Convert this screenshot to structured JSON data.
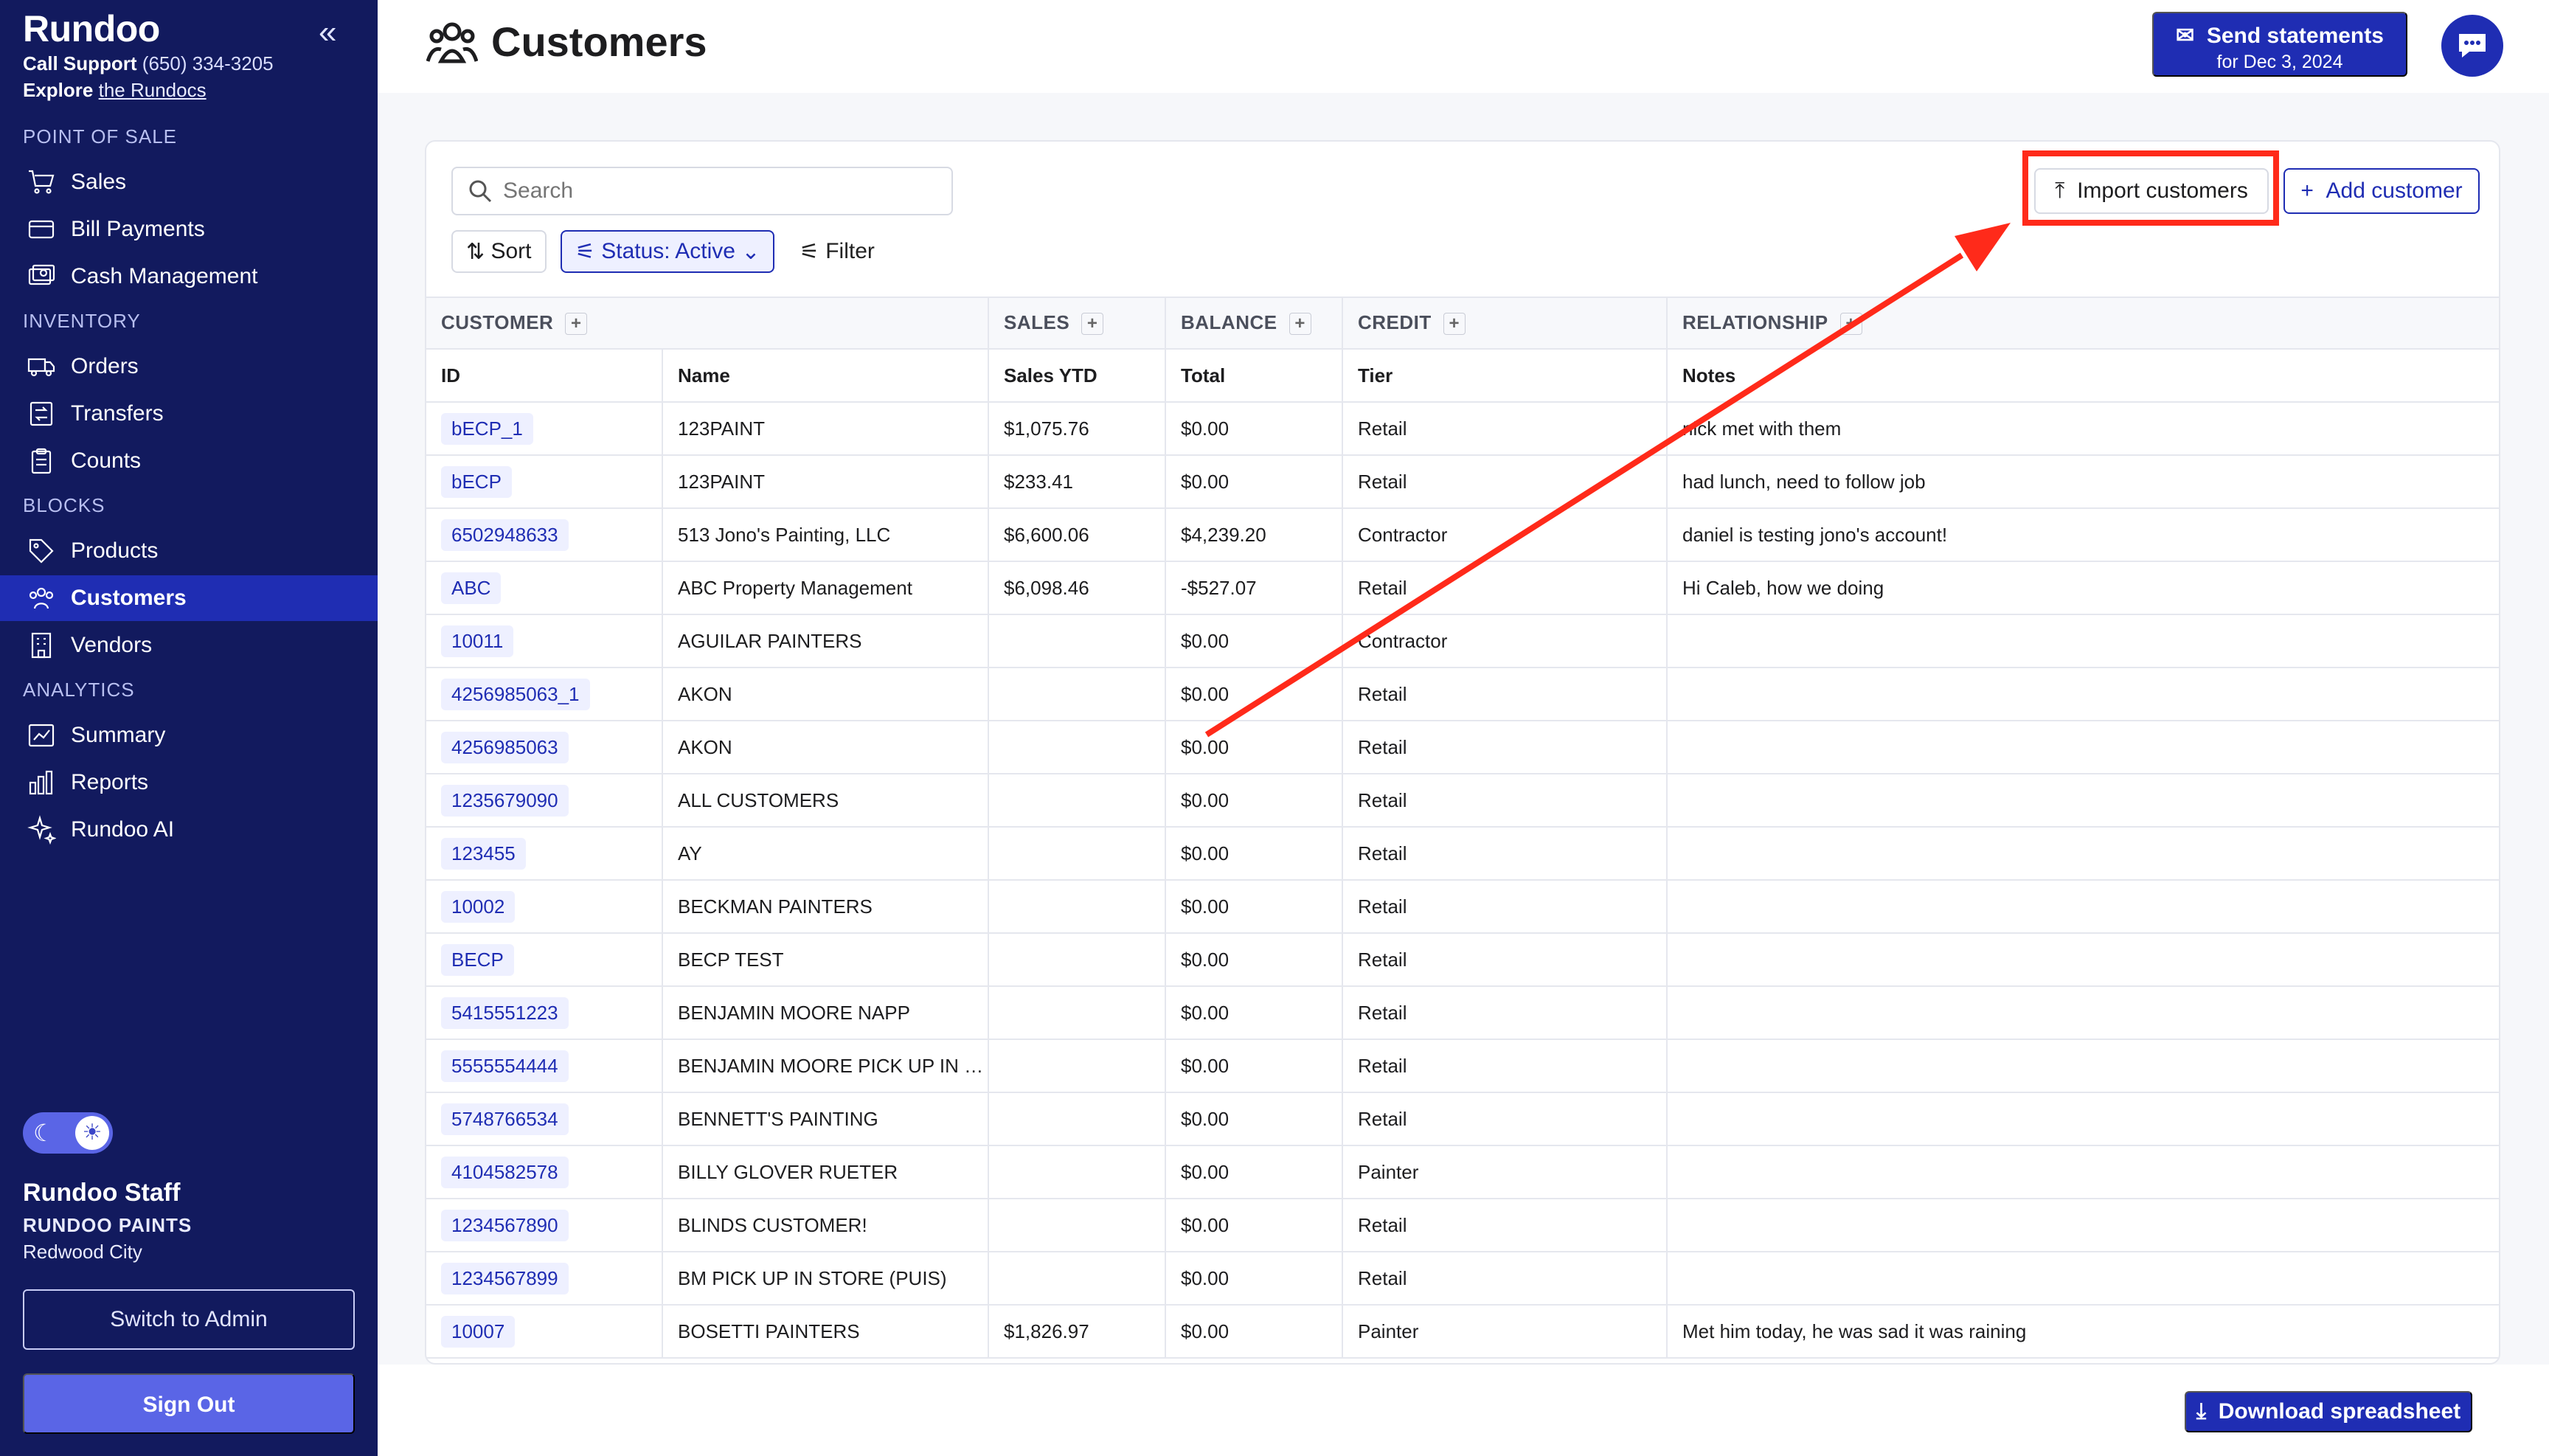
{
  "brand": "Rundoo",
  "support": {
    "label": "Call Support",
    "phone": "(650) 334-3205",
    "explore": "Explore",
    "explore_link": "the Rundocs"
  },
  "sidebar": {
    "sections": [
      {
        "title": "POINT OF SALE",
        "items": [
          {
            "label": "Sales",
            "icon": "cart-icon"
          },
          {
            "label": "Bill Payments",
            "icon": "credit-card-icon"
          },
          {
            "label": "Cash Management",
            "icon": "cash-icon"
          }
        ]
      },
      {
        "title": "INVENTORY",
        "items": [
          {
            "label": "Orders",
            "icon": "truck-icon"
          },
          {
            "label": "Transfers",
            "icon": "transfer-icon"
          },
          {
            "label": "Counts",
            "icon": "clipboard-icon"
          }
        ]
      },
      {
        "title": "BLOCKS",
        "items": [
          {
            "label": "Products",
            "icon": "tag-icon"
          },
          {
            "label": "Customers",
            "icon": "users-icon",
            "active": true
          },
          {
            "label": "Vendors",
            "icon": "building-icon"
          }
        ]
      },
      {
        "title": "ANALYTICS",
        "items": [
          {
            "label": "Summary",
            "icon": "chart-icon"
          },
          {
            "label": "Reports",
            "icon": "bar-chart-icon"
          },
          {
            "label": "Rundoo AI",
            "icon": "sparkle-icon"
          }
        ]
      }
    ]
  },
  "user": {
    "name": "Rundoo Staff",
    "org": "RUNDOO PAINTS",
    "city": "Redwood City"
  },
  "buttons": {
    "switch_admin": "Switch to Admin",
    "sign_out": "Sign Out",
    "send_statements": "Send statements",
    "send_statements_date": "for Dec 3, 2024",
    "import": "Import customers",
    "add": "Add customer",
    "download": "Download spreadsheet"
  },
  "page": {
    "title": "Customers"
  },
  "toolbar": {
    "search_placeholder": "Search",
    "sort": "Sort",
    "status": "Status: Active",
    "filter": "Filter"
  },
  "table": {
    "groups": [
      "CUSTOMER",
      "SALES",
      "BALANCE",
      "CREDIT",
      "RELATIONSHIP"
    ],
    "columns": [
      "ID",
      "Name",
      "Sales YTD",
      "Total",
      "Tier",
      "Notes"
    ],
    "rows": [
      [
        "bECP_1",
        "123PAINT",
        "$1,075.76",
        "$0.00",
        "Retail",
        "nick met with them"
      ],
      [
        "bECP",
        "123PAINT",
        "$233.41",
        "$0.00",
        "Retail",
        "had lunch, need to follow job"
      ],
      [
        "6502948633",
        "513 Jono's Painting, LLC",
        "$6,600.06",
        "$4,239.20",
        "Contractor",
        "daniel is testing jono's account!"
      ],
      [
        "ABC",
        "ABC Property Management",
        "$6,098.46",
        "-$527.07",
        "Retail",
        "Hi Caleb, how we doing"
      ],
      [
        "10011",
        "AGUILAR PAINTERS",
        "",
        "$0.00",
        "Contractor",
        ""
      ],
      [
        "4256985063_1",
        "AKON",
        "",
        "$0.00",
        "Retail",
        ""
      ],
      [
        "4256985063",
        "AKON",
        "",
        "$0.00",
        "Retail",
        ""
      ],
      [
        "1235679090",
        "ALL CUSTOMERS",
        "",
        "$0.00",
        "Retail",
        ""
      ],
      [
        "123455",
        "AY",
        "",
        "$0.00",
        "Retail",
        ""
      ],
      [
        "10002",
        "BECKMAN PAINTERS",
        "",
        "$0.00",
        "Retail",
        ""
      ],
      [
        "BECP",
        "BECP TEST",
        "",
        "$0.00",
        "Retail",
        ""
      ],
      [
        "5415551223",
        "BENJAMIN MOORE NAPP",
        "",
        "$0.00",
        "Retail",
        ""
      ],
      [
        "5555554444",
        "BENJAMIN MOORE PICK UP IN S...",
        "",
        "$0.00",
        "Retail",
        ""
      ],
      [
        "5748766534",
        "BENNETT'S PAINTING",
        "",
        "$0.00",
        "Retail",
        ""
      ],
      [
        "4104582578",
        "BILLY GLOVER RUETER",
        "",
        "$0.00",
        "Painter",
        ""
      ],
      [
        "1234567890",
        "BLINDS CUSTOMER!",
        "",
        "$0.00",
        "Retail",
        ""
      ],
      [
        "1234567899",
        "BM PICK UP IN STORE (PUIS)",
        "",
        "$0.00",
        "Retail",
        ""
      ],
      [
        "10007",
        "BOSETTI PAINTERS",
        "$1,826.97",
        "$0.00",
        "Painter",
        "Met him today, he was sad it was raining"
      ]
    ]
  },
  "colors": {
    "sidebar": "#121a5e",
    "accent": "#1f2db3",
    "highlight": "#ff2a1a"
  }
}
